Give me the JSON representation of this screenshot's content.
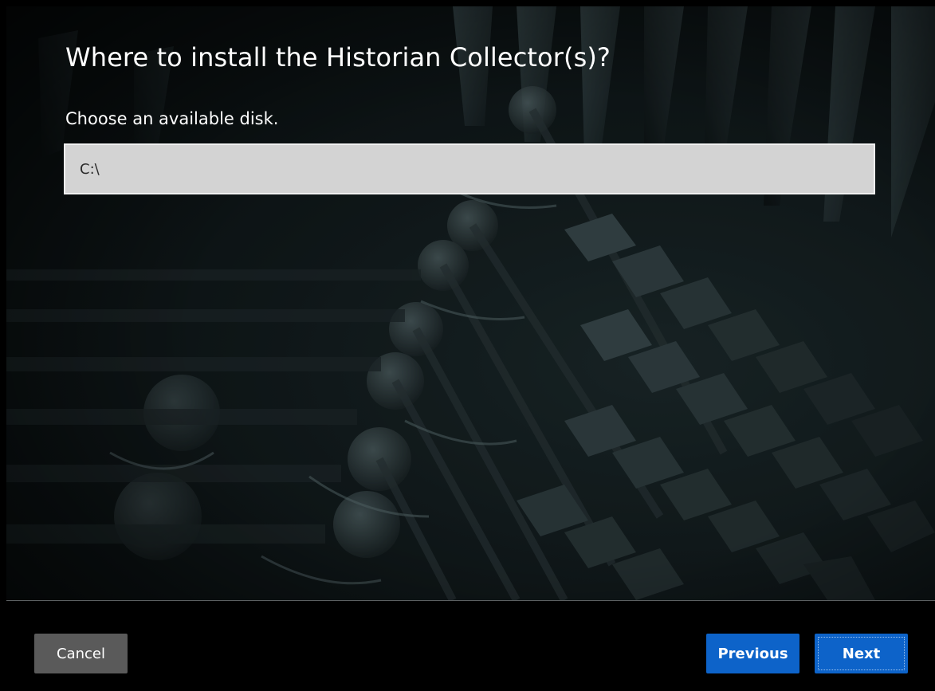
{
  "installer": {
    "title": "Where to install the Historian Collector(s)?",
    "subtitle": "Choose an available disk.",
    "disk_field": {
      "value": "C:\\"
    }
  },
  "footer": {
    "cancel_label": "Cancel",
    "previous_label": "Previous",
    "next_label": "Next"
  },
  "colors": {
    "primary_button": "#0d63c9",
    "secondary_button": "#5a5a5a",
    "field_background": "#d3d3d3",
    "footer_background": "#000000"
  },
  "icons": {
    "background": "turbine-blades-photo"
  }
}
